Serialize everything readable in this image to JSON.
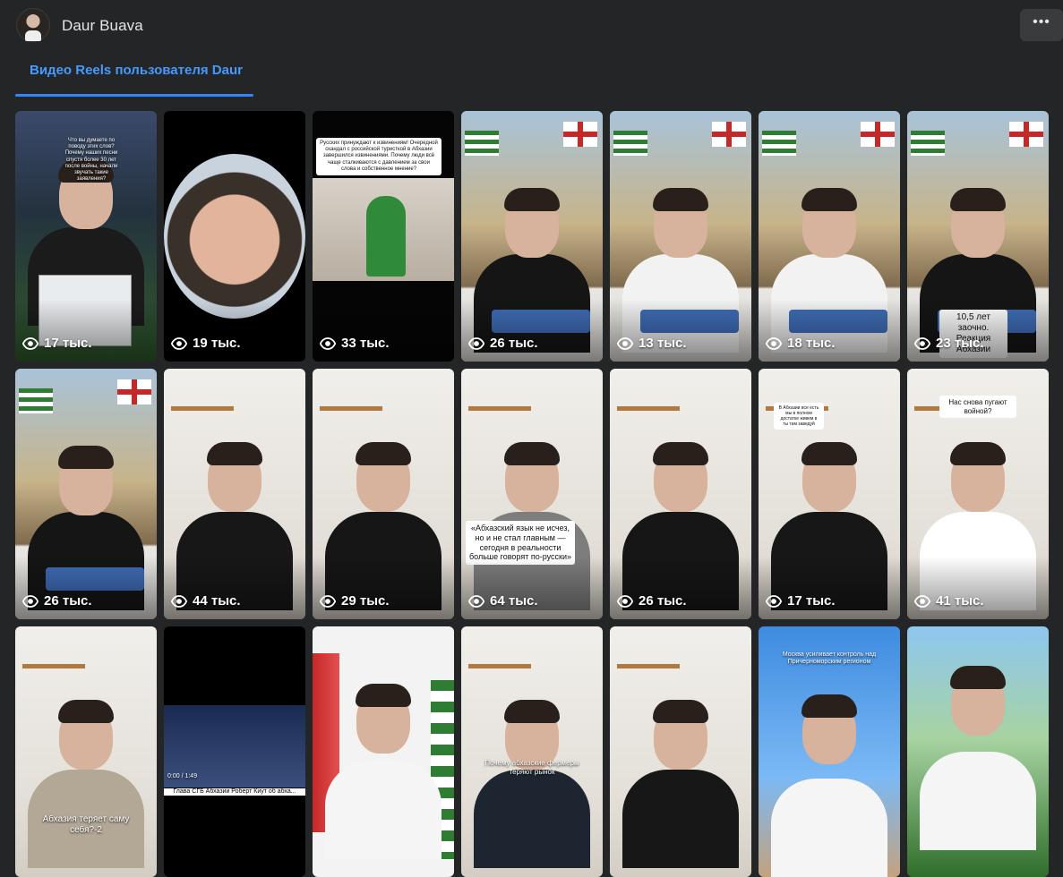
{
  "profile": {
    "name": "Daur Buava",
    "avatar_icon": "profile-photo"
  },
  "header": {
    "more_icon": "ellipsis-icon",
    "more_label": "•••"
  },
  "tabs": [
    {
      "label": "Видео Reels пользователя Daur",
      "active": true
    }
  ],
  "colors": {
    "background": "#242526",
    "accent": "#2d88ff",
    "tab_text": "#4599ff",
    "button_bg": "#3a3b3c"
  },
  "reels": [
    {
      "views": "17 тыс.",
      "caption": "Что вы думаете по поводу этих слов? Почему наших песни спустя более 30 лет после войны, начали звучать такие заявления?",
      "style": "night"
    },
    {
      "views": "19 тыс.",
      "caption": "",
      "style": "circle"
    },
    {
      "views": "33 тыс.",
      "caption": "Русских принуждают к извинениям! Очередной скандал с российской туристкой в Абхазии завершился извинениями. Почему люди всё чаще сталкиваются с давлением за свои слова и собственное мнение?",
      "style": "dark"
    },
    {
      "views": "26 тыс.",
      "caption": "",
      "style": "mural"
    },
    {
      "views": "13 тыс.",
      "caption": "",
      "style": "mural"
    },
    {
      "views": "18 тыс.",
      "caption": "",
      "style": "mural"
    },
    {
      "views": "23 тыс.",
      "caption": "10,5 лет заочно. Реакция Абхазии",
      "style": "mural"
    },
    {
      "views": "26 тыс.",
      "caption": "",
      "style": "mural"
    },
    {
      "views": "44 тыс.",
      "caption": "",
      "style": "room"
    },
    {
      "views": "29 тыс.",
      "caption": "",
      "style": "room"
    },
    {
      "views": "64 тыс.",
      "caption": "«Абхазский язык не исчез, но и не стал главным — сегодня в реальности больше говорят по-русски»",
      "style": "room"
    },
    {
      "views": "26 тыс.",
      "caption": "",
      "style": "room"
    },
    {
      "views": "17 тыс.",
      "caption": "В Абхазии все есть мы в полном достатке живем в ты там заведуй",
      "style": "room"
    },
    {
      "views": "41 тыс.",
      "caption": "Нас снова пугают войной?",
      "style": "room"
    },
    {
      "views": "",
      "caption": "Абхазия теряет саму себя?-2",
      "style": "room"
    },
    {
      "views": "",
      "caption": "Глава СГБ Абхазии Роберт Киут об абха...",
      "style": "player"
    },
    {
      "views": "",
      "caption": "",
      "style": "flags"
    },
    {
      "views": "",
      "caption": "Почему абхазские фермеры теряют рынок",
      "style": "room"
    },
    {
      "views": "",
      "caption": "",
      "style": "room"
    },
    {
      "views": "",
      "caption": "Москва усиливает контроль над Причерноморским регионом",
      "style": "sky"
    },
    {
      "views": "",
      "caption": "",
      "style": "park"
    }
  ],
  "player": {
    "time": "0:00 / 1:49"
  }
}
